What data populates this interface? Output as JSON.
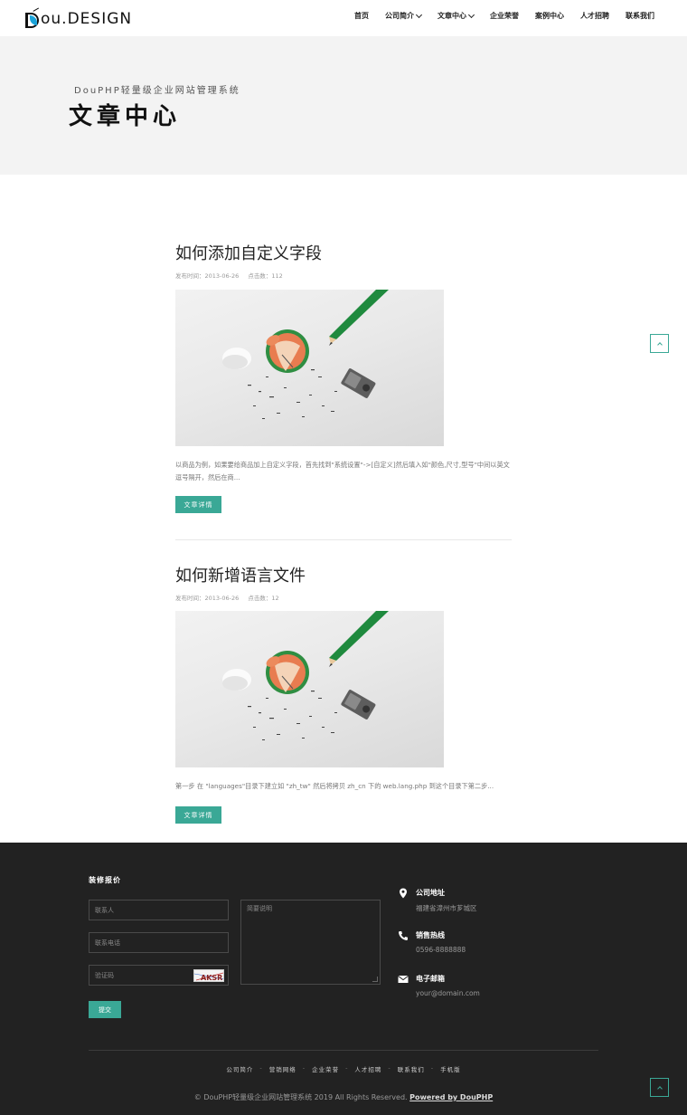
{
  "header": {
    "logo_text": "ou.DESIGN",
    "nav": [
      {
        "label": "首页",
        "has_dropdown": false
      },
      {
        "label": "公司简介",
        "has_dropdown": true
      },
      {
        "label": "文章中心",
        "has_dropdown": true
      },
      {
        "label": "企业荣誉",
        "has_dropdown": false
      },
      {
        "label": "案例中心",
        "has_dropdown": false
      },
      {
        "label": "人才招聘",
        "has_dropdown": false
      },
      {
        "label": "联系我们",
        "has_dropdown": false
      }
    ]
  },
  "banner": {
    "subtitle": "DouPHP轻量级企业网站管理系统",
    "title": "文章中心"
  },
  "articles": [
    {
      "title": "如何添加自定义字段",
      "date_label": "发布时间：2013-06-26",
      "clicks_label": "点击数：112",
      "description": "以商品为例，如果要给商品加上自定义字段，首先找到\"系统设置\"->[自定义]然后填入如\"颜色,尺寸,型号\"中间以英文逗号隔开，然后在商...",
      "button": "文章详情"
    },
    {
      "title": "如何新增语言文件",
      "date_label": "发布时间：2013-06-26",
      "clicks_label": "点击数：12",
      "description": "第一步 在 \"languages\"目录下建立如 \"zh_tw\" 然后将拷贝 zh_cn 下的 web.lang.php 到这个目录下第二步...",
      "button": "文章详情"
    }
  ],
  "footer": {
    "form_heading": "装修报价",
    "fields": {
      "name_placeholder": "联系人",
      "phone_placeholder": "联系电话",
      "captcha_placeholder": "验证码",
      "captcha_text": "AKSR",
      "message_placeholder": "简要说明"
    },
    "submit": "提交",
    "contact": [
      {
        "icon": "map-marker-icon",
        "label": "公司地址",
        "value": "福建省漳州市芗城区"
      },
      {
        "icon": "phone-icon",
        "label": "销售热线",
        "value": "0596-8888888"
      },
      {
        "icon": "envelope-icon",
        "label": "电子邮箱",
        "value": "your@domain.com"
      }
    ],
    "links": [
      "公司简介",
      "营销网络",
      "企业荣誉",
      "人才招聘",
      "联系我们",
      "手机版"
    ],
    "copyright": "© DouPHP轻量级企业网站管理系统 2019 All Rights Reserved.",
    "powered_by": "Powered by DouPHP"
  },
  "colors": {
    "accent": "#3aa896",
    "footer_bg": "#222222",
    "banner_bg": "#f3f3f3",
    "logo_blue": "#1aa3d9"
  }
}
